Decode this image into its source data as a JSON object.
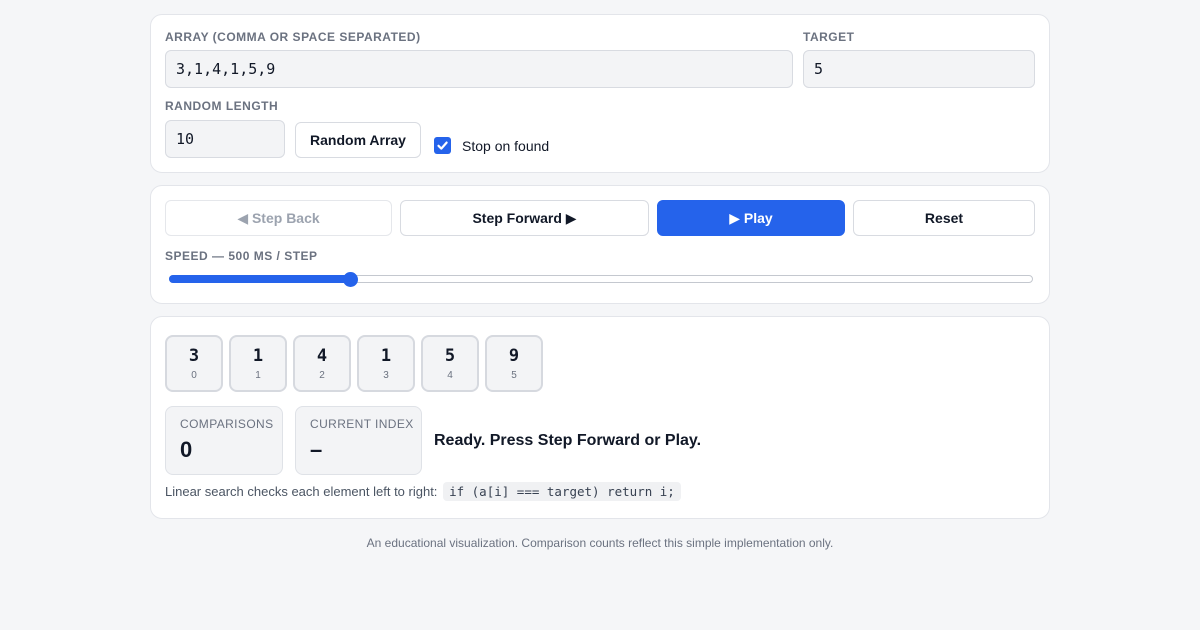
{
  "inputs": {
    "array_label": "ARRAY (COMMA OR SPACE SEPARATED)",
    "array_value": "3,1,4,1,5,9",
    "target_label": "TARGET",
    "target_value": "5",
    "random_length_label": "RANDOM LENGTH",
    "random_length_value": "10",
    "random_button": "Random Array",
    "stop_on_found_label": "Stop on found",
    "stop_on_found_checked": true
  },
  "controls": {
    "step_back": "◀ Step Back",
    "step_forward": "Step Forward ▶",
    "play": "▶ Play",
    "reset": "Reset",
    "speed_label": "SPEED — 500 MS / STEP",
    "speed_fraction": 0.21
  },
  "array_cells": [
    {
      "value": "3",
      "index": "0"
    },
    {
      "value": "1",
      "index": "1"
    },
    {
      "value": "4",
      "index": "2"
    },
    {
      "value": "1",
      "index": "3"
    },
    {
      "value": "5",
      "index": "4"
    },
    {
      "value": "9",
      "index": "5"
    }
  ],
  "stats": {
    "comparisons_label": "COMPARISONS",
    "comparisons_value": "0",
    "current_index_label": "CURRENT INDEX",
    "current_index_value": "–"
  },
  "status_message": "Ready. Press Step Forward or Play.",
  "explanation": {
    "text": "Linear search checks each element left to right:",
    "code": "if (a[i] === target) return i;"
  },
  "footer": "An educational visualization. Comparison counts reflect this simple implementation only.",
  "colors": {
    "accent": "#2563eb",
    "background": "#f5f6f8",
    "card": "#ffffff"
  }
}
